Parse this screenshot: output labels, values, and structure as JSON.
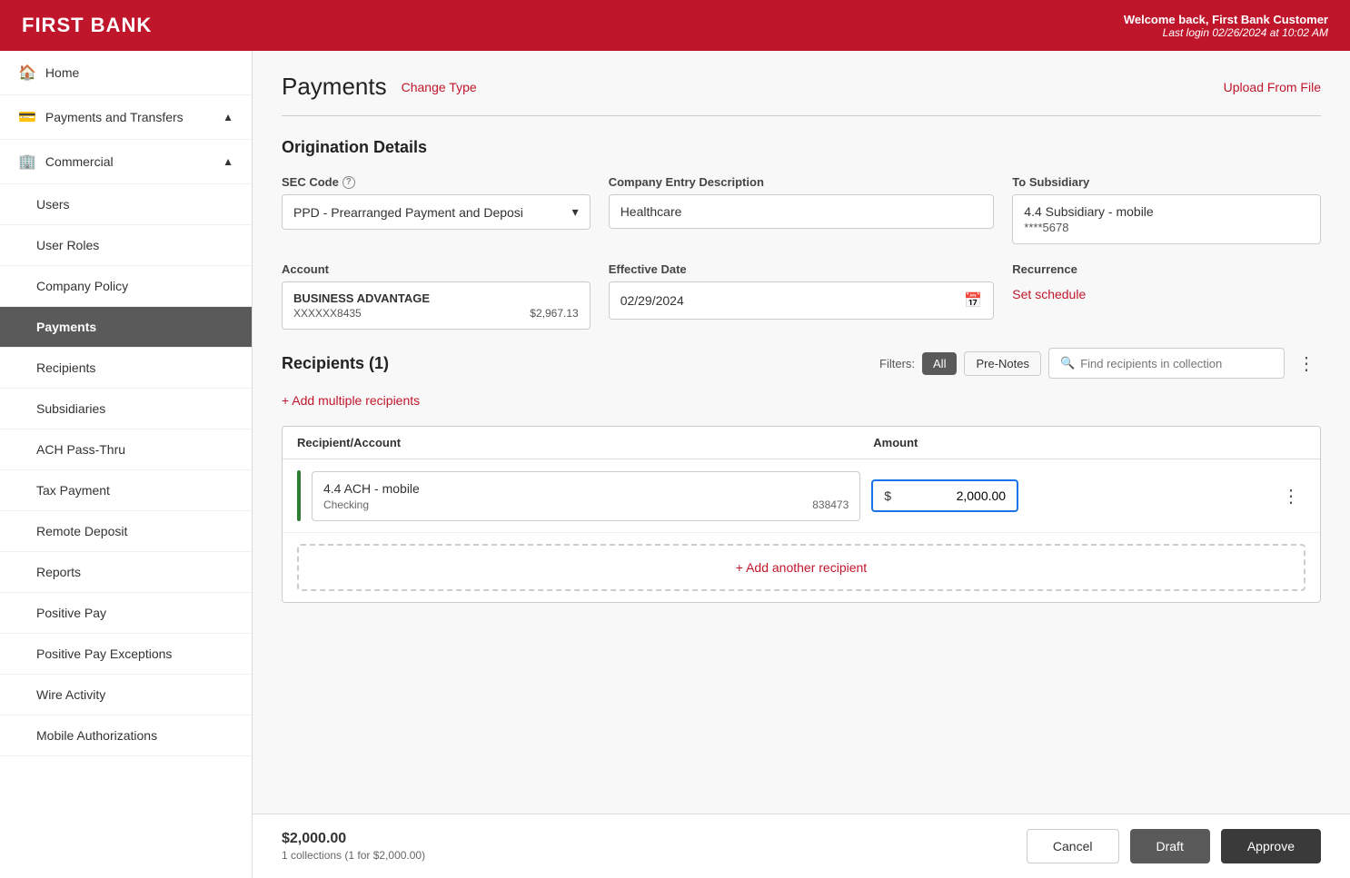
{
  "header": {
    "logo": "FIRST BANK",
    "welcome": "Welcome back, First Bank Customer",
    "last_login": "Last login 02/26/2024 at 10:02 AM"
  },
  "sidebar": {
    "items": [
      {
        "id": "home",
        "label": "Home",
        "icon": "🏠",
        "level": "top"
      },
      {
        "id": "payments-transfers",
        "label": "Payments and Transfers",
        "icon": "💳",
        "level": "top",
        "expanded": true
      },
      {
        "id": "commercial",
        "label": "Commercial",
        "icon": "🏢",
        "level": "top",
        "expanded": true
      },
      {
        "id": "users",
        "label": "Users",
        "level": "sub"
      },
      {
        "id": "user-roles",
        "label": "User Roles",
        "level": "sub"
      },
      {
        "id": "company-policy",
        "label": "Company Policy",
        "level": "sub"
      },
      {
        "id": "payments",
        "label": "Payments",
        "level": "sub",
        "active": true
      },
      {
        "id": "recipients",
        "label": "Recipients",
        "level": "sub"
      },
      {
        "id": "subsidiaries",
        "label": "Subsidiaries",
        "level": "sub"
      },
      {
        "id": "ach-pass-thru",
        "label": "ACH Pass-Thru",
        "level": "sub"
      },
      {
        "id": "tax-payment",
        "label": "Tax Payment",
        "level": "sub"
      },
      {
        "id": "remote-deposit",
        "label": "Remote Deposit",
        "level": "sub"
      },
      {
        "id": "reports",
        "label": "Reports",
        "level": "sub"
      },
      {
        "id": "positive-pay",
        "label": "Positive Pay",
        "level": "sub"
      },
      {
        "id": "positive-pay-exceptions",
        "label": "Positive Pay Exceptions",
        "level": "sub"
      },
      {
        "id": "wire-activity",
        "label": "Wire Activity",
        "level": "sub"
      },
      {
        "id": "mobile-authorizations",
        "label": "Mobile Authorizations",
        "level": "sub"
      }
    ]
  },
  "page": {
    "title": "Payments",
    "change_type": "Change Type",
    "upload_from_file": "Upload From File"
  },
  "origination": {
    "section_title": "Origination Details",
    "sec_code_label": "SEC Code",
    "sec_code_value": "PPD - Prearranged Payment and Deposi",
    "company_entry_label": "Company Entry Description",
    "company_entry_value": "Healthcare",
    "to_subsidiary_label": "To Subsidiary",
    "subsidiary_name": "4.4 Subsidiary - mobile",
    "subsidiary_acct": "****5678",
    "account_label": "Account",
    "account_name": "BUSINESS ADVANTAGE",
    "account_number": "XXXXXX8435",
    "account_balance": "$2,967.13",
    "effective_date_label": "Effective Date",
    "effective_date_value": "02/29/2024",
    "recurrence_label": "Recurrence",
    "set_schedule_label": "Set schedule"
  },
  "recipients": {
    "section_title": "Recipients (1)",
    "filters_label": "Filters:",
    "filter_all": "All",
    "filter_prenotes": "Pre-Notes",
    "search_placeholder": "Find recipients in collection",
    "add_multiple": "+ Add multiple recipients",
    "table_col_recipient": "Recipient/Account",
    "table_col_amount": "Amount",
    "rows": [
      {
        "name": "4.4 ACH - mobile",
        "type": "Checking",
        "number": "838473",
        "amount": "2,000.00"
      }
    ],
    "add_another": "+ Add another recipient"
  },
  "footer": {
    "total": "$2,000.00",
    "sub": "1 collections (1 for $2,000.00)",
    "cancel_label": "Cancel",
    "draft_label": "Draft",
    "approve_label": "Approve"
  }
}
